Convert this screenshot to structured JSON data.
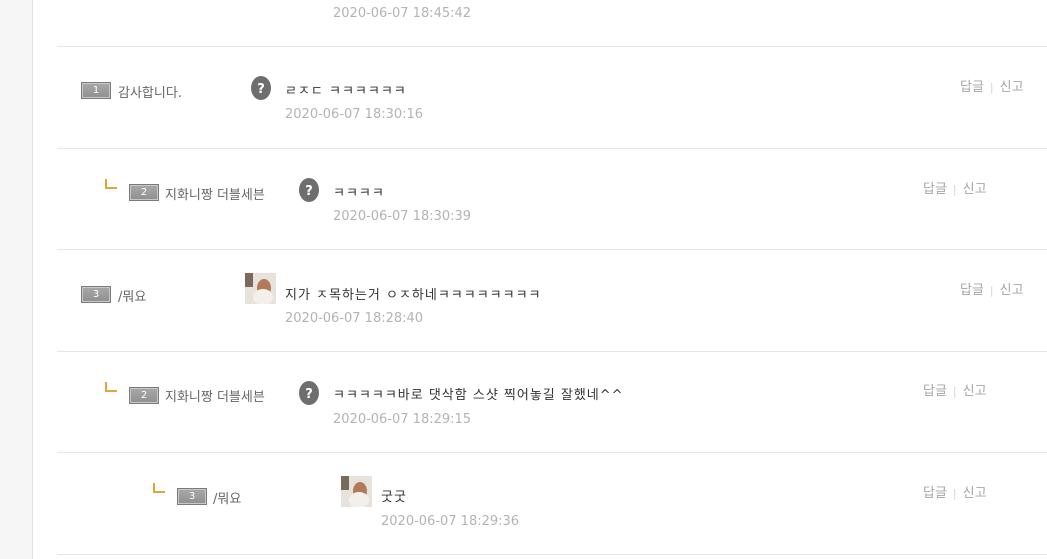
{
  "colors": {
    "reply_mark": "#e6a23c",
    "timestamp": "#b3b3b3",
    "action": "#a6a6a6",
    "level_badge": "#9b9b9b"
  },
  "actions": {
    "reply": "답글",
    "separator": "|",
    "report": "신고"
  },
  "top_timestamp": "2020-06-07 18:45:42",
  "comments": [
    {
      "level": "1",
      "nickname": "감사합니다.",
      "avatar": "egg-icon",
      "text": "ㄹㅈㄷ ㅋㅋㅋㅋㅋㅋ",
      "timestamp": "2020-06-07 18:30:16",
      "depth": 0
    },
    {
      "level": "2",
      "nickname": "지화니짱 더블세븐",
      "avatar": "egg-icon",
      "text": "ㅋㅋㅋㅋ",
      "timestamp": "2020-06-07 18:30:39",
      "depth": 1
    },
    {
      "level": "3",
      "nickname": "/뭐요",
      "avatar": "photo-avatar",
      "text": "지가 ㅈ목하는거 ㅇㅈ하네ㅋㅋㅋㅋㅋㅋㅋㅋ",
      "timestamp": "2020-06-07 18:28:40",
      "depth": 0
    },
    {
      "level": "2",
      "nickname": "지화니짱 더블세븐",
      "avatar": "egg-icon",
      "text": "ㅋㅋㅋㅋㅋ바로 댓삭함 스샷 찍어놓길 잘했네^^",
      "timestamp": "2020-06-07 18:29:15",
      "depth": 1
    },
    {
      "level": "3",
      "nickname": "/뭐요",
      "avatar": "photo-avatar",
      "text": "굿굿",
      "timestamp": "2020-06-07 18:29:36",
      "depth": 2
    }
  ]
}
